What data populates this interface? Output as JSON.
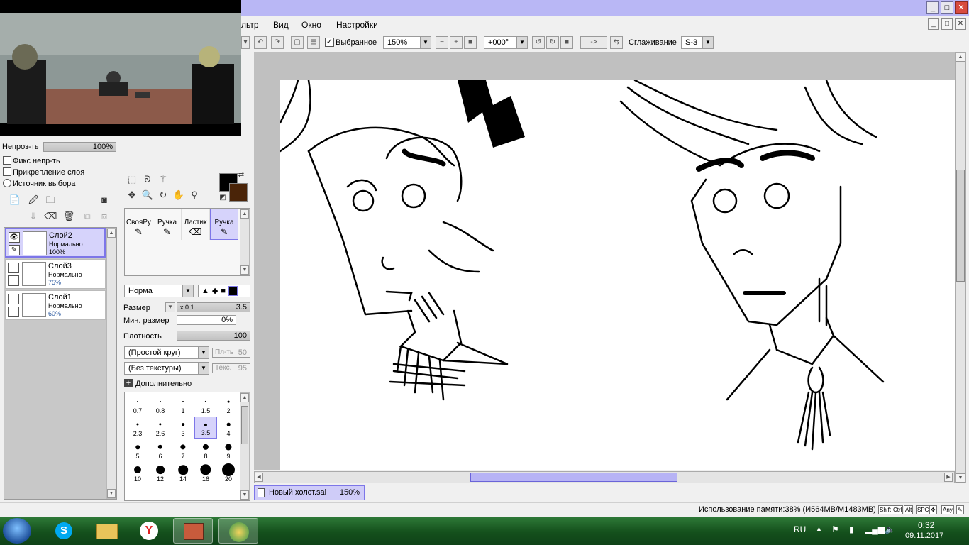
{
  "menu": {
    "filter": "льтр",
    "view": "Вид",
    "window": "Окно",
    "settings": "Настройки"
  },
  "toolbar": {
    "selected_label": "Выбранное",
    "zoom": "150%",
    "rotation": "+000°",
    "arrow_btn": "->",
    "smoothing_label": "Сглаживание",
    "smoothing_value": "S-3"
  },
  "left": {
    "opacity_label": "Непроз-ть",
    "opacity_value": "100%",
    "fix_opacity": "Фикс непр-ть",
    "clip_layer": "Прикрепление слоя",
    "source_select": "Источник выбора",
    "layers": [
      {
        "name": "Слой2",
        "mode": "Нормально",
        "opacity": "100%"
      },
      {
        "name": "Слой3",
        "mode": "Нормально",
        "opacity": "75%"
      },
      {
        "name": "Слой1",
        "mode": "Нормально",
        "opacity": "60%"
      }
    ]
  },
  "tools": {
    "brushes": [
      "СвояРу",
      "Ручка",
      "Ластик",
      "Ручка"
    ],
    "blend_mode": "Норма",
    "size_label": "Размер",
    "size_mult": "x 0.1",
    "size_value": "3.5",
    "min_size_label": "Мин. размер",
    "min_size_value": "0%",
    "density_label": "Плотность",
    "density_value": "100",
    "shape": "(Простой круг)",
    "shape_amount_label": "Пл-ть",
    "shape_amount": "50",
    "texture": "(Без текстуры)",
    "texture_amount_label": "Текс.",
    "texture_amount": "95",
    "advanced": "Дополнительно",
    "sizes": [
      "0.7",
      "0.8",
      "1",
      "1.5",
      "2",
      "2.3",
      "2.6",
      "3",
      "3.5",
      "4",
      "5",
      "6",
      "7",
      "8",
      "9",
      "10",
      "12",
      "14",
      "16",
      "20"
    ],
    "selected_size": "3.5"
  },
  "document": {
    "tab_name": "Новый холст.sai",
    "tab_zoom": "150%"
  },
  "status": {
    "memory": "Использование памяти:38% (И564MB/M1483MB)",
    "keys": [
      "Shift",
      "Ctrl",
      "Alt",
      "SPC",
      "Any"
    ]
  },
  "taskbar": {
    "lang": "RU",
    "time": "0:32",
    "date": "09.11.2017"
  },
  "colors": {
    "primary": "#000000",
    "secondary": "#4a2408",
    "accent": "#b9b7f5"
  }
}
